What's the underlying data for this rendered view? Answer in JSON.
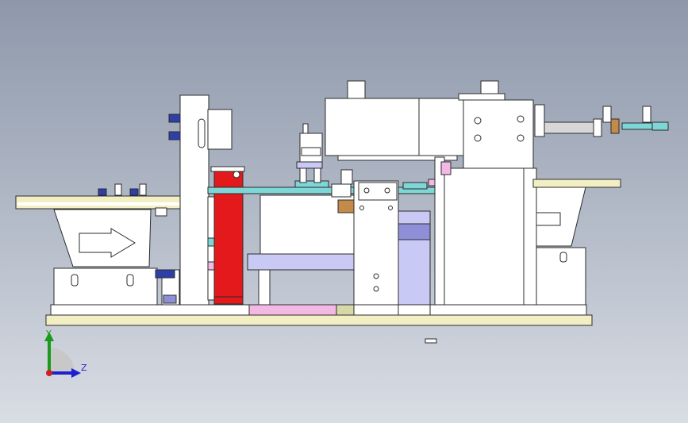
{
  "view": {
    "background_top": "#8e98aa",
    "background_bottom": "#d9dde4"
  },
  "triad": {
    "y_label": "Y",
    "z_label": "Z",
    "y_color": "#1a9a1a",
    "z_color": "#1f1fd0",
    "origin_color": "#d01f1f"
  },
  "colors": {
    "outline": "#2b2b2b",
    "white_parts": "#ffffff",
    "base_plate": "#f3efc4",
    "red_cylinder": "#e3191c",
    "teal_rail": "#7fd6d6",
    "pink_block": "#f4b8e4",
    "lavender_block": "#c9c9f5",
    "purple_block": "#8f8fd8",
    "brown_block": "#c48a4a",
    "grey_part": "#d7d7d7"
  }
}
